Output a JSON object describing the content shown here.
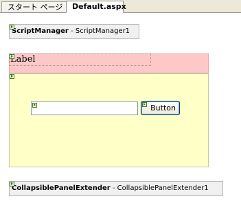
{
  "tabs": [
    {
      "label": "スタート ページ",
      "active": false
    },
    {
      "label": "Default.aspx",
      "active": true
    }
  ],
  "script_manager": {
    "type": "ScriptManager",
    "separator": " - ",
    "id": "ScriptManager1"
  },
  "label_control": {
    "text": "Label"
  },
  "button_control": {
    "text": "Button"
  },
  "textbox_control": {
    "value": ""
  },
  "extender": {
    "type": "CollapsiblePanelExtender",
    "separator": " - ",
    "id": "CollapsiblePanelExtender1"
  },
  "colors": {
    "header_panel": "#ffc8c8",
    "content_panel": "#ffffc8",
    "component_box": "#f0f0f0"
  }
}
